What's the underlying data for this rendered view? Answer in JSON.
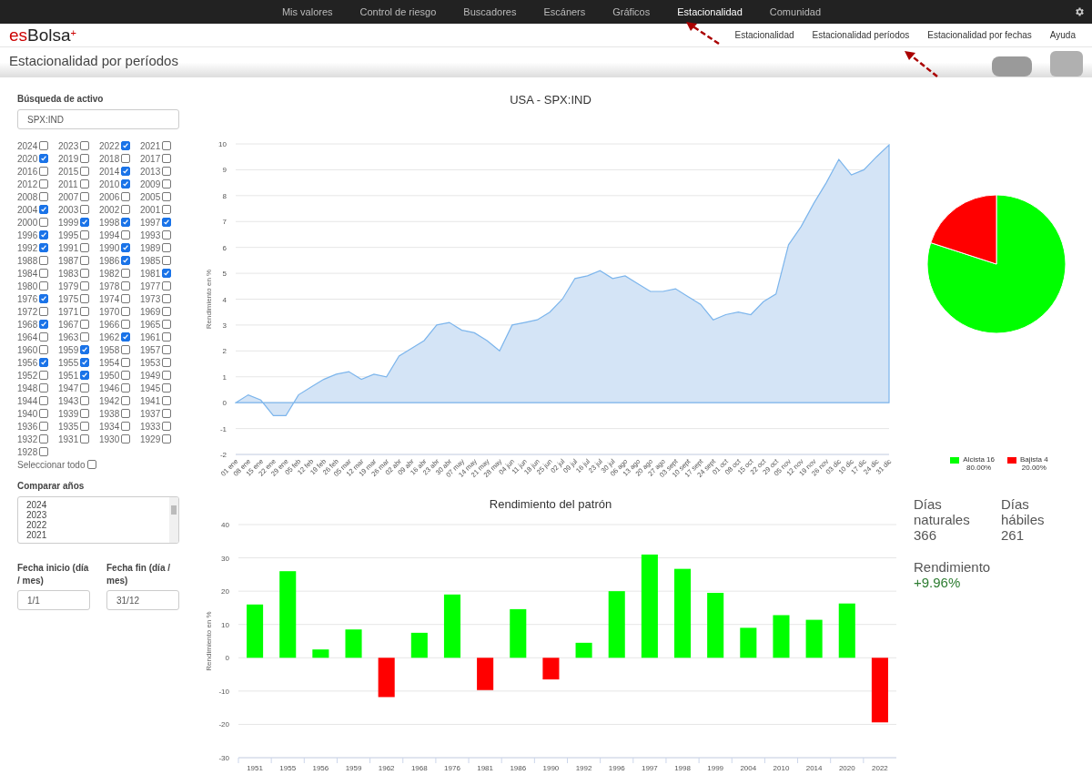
{
  "top_nav": [
    {
      "label": "Mis valores",
      "selected": false
    },
    {
      "label": "Control de riesgo",
      "selected": false
    },
    {
      "label": "Buscadores",
      "selected": false
    },
    {
      "label": "Escáners",
      "selected": false
    },
    {
      "label": "Gráficos",
      "selected": false
    },
    {
      "label": "Estacionalidad",
      "selected": true
    },
    {
      "label": "Comunidad",
      "selected": false
    }
  ],
  "logo": {
    "prefix": "es",
    "name": "Bolsa",
    "mark": "+"
  },
  "sub_nav": [
    "Estacionalidad",
    "Estacionalidad períodos",
    "Estacionalidad por fechas",
    "Ayuda"
  ],
  "page_title": "Estacionalidad por períodos",
  "search": {
    "label": "Búsqueda de activo",
    "value": "SPX:IND"
  },
  "years": [
    {
      "label": "2024",
      "checked": false
    },
    {
      "label": "2023",
      "checked": false
    },
    {
      "label": "2022",
      "checked": true
    },
    {
      "label": "2021",
      "checked": false
    },
    {
      "label": "2020",
      "checked": true
    },
    {
      "label": "2019",
      "checked": false
    },
    {
      "label": "2018",
      "checked": false
    },
    {
      "label": "2017",
      "checked": false
    },
    {
      "label": "2016",
      "checked": false
    },
    {
      "label": "2015",
      "checked": false
    },
    {
      "label": "2014",
      "checked": true
    },
    {
      "label": "2013",
      "checked": false
    },
    {
      "label": "2012",
      "checked": false
    },
    {
      "label": "2011",
      "checked": false
    },
    {
      "label": "2010",
      "checked": true
    },
    {
      "label": "2009",
      "checked": false
    },
    {
      "label": "2008",
      "checked": false
    },
    {
      "label": "2007",
      "checked": false
    },
    {
      "label": "2006",
      "checked": false
    },
    {
      "label": "2005",
      "checked": false
    },
    {
      "label": "2004",
      "checked": true
    },
    {
      "label": "2003",
      "checked": false
    },
    {
      "label": "2002",
      "checked": false
    },
    {
      "label": "2001",
      "checked": false
    },
    {
      "label": "2000",
      "checked": false
    },
    {
      "label": "1999",
      "checked": true
    },
    {
      "label": "1998",
      "checked": true
    },
    {
      "label": "1997",
      "checked": true
    },
    {
      "label": "1996",
      "checked": true
    },
    {
      "label": "1995",
      "checked": false
    },
    {
      "label": "1994",
      "checked": false
    },
    {
      "label": "1993",
      "checked": false
    },
    {
      "label": "1992",
      "checked": true
    },
    {
      "label": "1991",
      "checked": false
    },
    {
      "label": "1990",
      "checked": true
    },
    {
      "label": "1989",
      "checked": false
    },
    {
      "label": "1988",
      "checked": false
    },
    {
      "label": "1987",
      "checked": false
    },
    {
      "label": "1986",
      "checked": true
    },
    {
      "label": "1985",
      "checked": false
    },
    {
      "label": "1984",
      "checked": false
    },
    {
      "label": "1983",
      "checked": false
    },
    {
      "label": "1982",
      "checked": false
    },
    {
      "label": "1981",
      "checked": true
    },
    {
      "label": "1980",
      "checked": false
    },
    {
      "label": "1979",
      "checked": false
    },
    {
      "label": "1978",
      "checked": false
    },
    {
      "label": "1977",
      "checked": false
    },
    {
      "label": "1976",
      "checked": true
    },
    {
      "label": "1975",
      "checked": false
    },
    {
      "label": "1974",
      "checked": false
    },
    {
      "label": "1973",
      "checked": false
    },
    {
      "label": "1972",
      "checked": false
    },
    {
      "label": "1971",
      "checked": false
    },
    {
      "label": "1970",
      "checked": false
    },
    {
      "label": "1969",
      "checked": false
    },
    {
      "label": "1968",
      "checked": true
    },
    {
      "label": "1967",
      "checked": false
    },
    {
      "label": "1966",
      "checked": false
    },
    {
      "label": "1965",
      "checked": false
    },
    {
      "label": "1964",
      "checked": false
    },
    {
      "label": "1963",
      "checked": false
    },
    {
      "label": "1962",
      "checked": true
    },
    {
      "label": "1961",
      "checked": false
    },
    {
      "label": "1960",
      "checked": false
    },
    {
      "label": "1959",
      "checked": true
    },
    {
      "label": "1958",
      "checked": false
    },
    {
      "label": "1957",
      "checked": false
    },
    {
      "label": "1956",
      "checked": true
    },
    {
      "label": "1955",
      "checked": true
    },
    {
      "label": "1954",
      "checked": false
    },
    {
      "label": "1953",
      "checked": false
    },
    {
      "label": "1952",
      "checked": false
    },
    {
      "label": "1951",
      "checked": true
    },
    {
      "label": "1950",
      "checked": false
    },
    {
      "label": "1949",
      "checked": false
    },
    {
      "label": "1948",
      "checked": false
    },
    {
      "label": "1947",
      "checked": false
    },
    {
      "label": "1946",
      "checked": false
    },
    {
      "label": "1945",
      "checked": false
    },
    {
      "label": "1944",
      "checked": false
    },
    {
      "label": "1943",
      "checked": false
    },
    {
      "label": "1942",
      "checked": false
    },
    {
      "label": "1941",
      "checked": false
    },
    {
      "label": "1940",
      "checked": false
    },
    {
      "label": "1939",
      "checked": false
    },
    {
      "label": "1938",
      "checked": false
    },
    {
      "label": "1937",
      "checked": false
    },
    {
      "label": "1936",
      "checked": false
    },
    {
      "label": "1935",
      "checked": false
    },
    {
      "label": "1934",
      "checked": false
    },
    {
      "label": "1933",
      "checked": false
    },
    {
      "label": "1932",
      "checked": false
    },
    {
      "label": "1931",
      "checked": false
    },
    {
      "label": "1930",
      "checked": false
    },
    {
      "label": "1929",
      "checked": false
    },
    {
      "label": "1928",
      "checked": false
    }
  ],
  "select_all": {
    "label": "Seleccionar todo",
    "checked": false
  },
  "compare": {
    "label": "Comparar años",
    "options": [
      "2024",
      "2023",
      "2022",
      "2021"
    ]
  },
  "start_date": {
    "label": "Fecha inicio (día / mes)",
    "value": "1/1"
  },
  "end_date": {
    "label": "Fecha fin (día / mes)",
    "value": "31/12"
  },
  "seasonal_chart": {
    "chart_data": {
      "type": "area",
      "title": "USA - SPX:IND",
      "ylabel": "Rendimiento en %",
      "categories": [
        "01 ene",
        "08 ene",
        "15 ene",
        "22 ene",
        "29 ene",
        "05 feb",
        "12 feb",
        "19 feb",
        "26 feb",
        "05 mar",
        "12 mar",
        "19 mar",
        "26 mar",
        "02 abr",
        "09 abr",
        "16 abr",
        "23 abr",
        "30 abr",
        "07 may",
        "14 may",
        "21 may",
        "28 may",
        "04 jun",
        "11 jun",
        "18 jun",
        "25 jun",
        "02 jul",
        "09 jul",
        "16 jul",
        "23 jul",
        "30 jul",
        "06 ago",
        "13 ago",
        "20 ago",
        "27 ago",
        "03 sept",
        "10 sept",
        "17 sept",
        "24 sept",
        "01 oct",
        "08 oct",
        "15 oct",
        "22 oct",
        "29 oct",
        "05 nov",
        "12 nov",
        "19 nov",
        "26 nov",
        "03 dic",
        "10 dic",
        "17 dic",
        "24 dic",
        "31 dic"
      ],
      "series": [
        {
          "color": "#7cb5ec",
          "values": [
            0,
            0.3,
            0.1,
            -0.5,
            -0.5,
            0.3,
            0.6,
            0.9,
            1.1,
            1.2,
            0.9,
            1.1,
            1.0,
            1.8,
            2.1,
            2.4,
            3.0,
            3.1,
            2.8,
            2.7,
            2.4,
            2.0,
            3.0,
            3.1,
            3.2,
            3.5,
            4.0,
            4.8,
            4.9,
            5.1,
            4.8,
            4.9,
            4.6,
            4.3,
            4.3,
            4.4,
            4.1,
            3.8,
            3.2,
            3.4,
            3.5,
            3.4,
            3.9,
            4.2,
            6.1,
            6.8,
            7.7,
            8.5,
            9.4,
            8.8,
            9.0,
            9.5,
            9.96
          ]
        }
      ],
      "grid": true,
      "ylim": [
        -2,
        10
      ],
      "yticks": [
        -2,
        -1,
        0,
        1,
        2,
        3,
        4,
        5,
        6,
        7,
        8,
        9,
        10
      ]
    }
  },
  "pattern_chart": {
    "chart_data": {
      "type": "bar",
      "title": "Rendimiento del patrón",
      "ylabel": "Rendimiento en %",
      "categories": [
        "1951",
        "1955",
        "1956",
        "1959",
        "1962",
        "1968",
        "1976",
        "1981",
        "1986",
        "1990",
        "1992",
        "1996",
        "1997",
        "1998",
        "1999",
        "2004",
        "2010",
        "2014",
        "2020",
        "2022"
      ],
      "series": [
        {
          "color": "#00ff00",
          "values": [
            16,
            26,
            2.5,
            8.5,
            null,
            7.5,
            19,
            null,
            14.6,
            null,
            4.5,
            20,
            31,
            26.7,
            19.5,
            9,
            12.8,
            11.4,
            16.3,
            null
          ]
        },
        {
          "color": "#ff0000",
          "values": [
            null,
            null,
            null,
            null,
            -11.8,
            null,
            null,
            -9.7,
            null,
            -6.5,
            null,
            null,
            null,
            null,
            null,
            null,
            null,
            null,
            null,
            -19.4
          ]
        }
      ],
      "grid": true,
      "ylim": [
        -30,
        40
      ],
      "yticks": [
        -30,
        -20,
        -10,
        0,
        10,
        20,
        30,
        40
      ]
    }
  },
  "pie_chart": {
    "chart_data": {
      "type": "pie",
      "categories": [
        "Alcista 16",
        "Bajista 4"
      ],
      "series": [
        {
          "values": [
            80,
            20
          ],
          "colors": [
            "#00ff00",
            "#ff0000"
          ]
        }
      ]
    },
    "legend": [
      {
        "percent": "80.00%"
      },
      {
        "percent": "20.00%"
      }
    ]
  },
  "stats": [
    {
      "label": "Días naturales",
      "value": "366",
      "kind": "plain"
    },
    {
      "label": "Días hábiles",
      "value": "261",
      "kind": "plain"
    },
    {
      "label": "Rendimiento",
      "value": "+9.96%",
      "kind": "positive"
    }
  ]
}
